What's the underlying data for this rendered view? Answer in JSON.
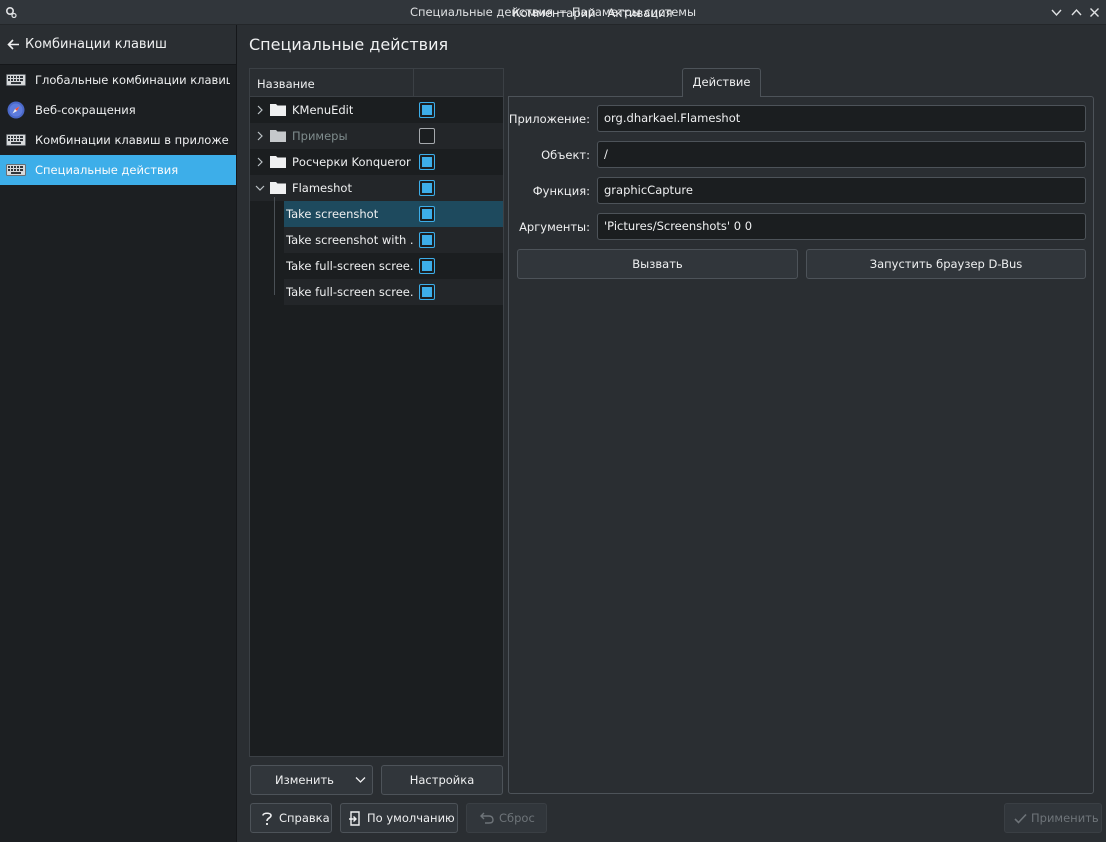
{
  "window": {
    "title": "Специальные действия — Параметры системы",
    "icons": [
      "settings-icon",
      "chevron-down-icon",
      "chevron-up-icon",
      "close-icon"
    ]
  },
  "sidebar": {
    "back_label": "Комбинации клавиш",
    "items": [
      {
        "label": "Глобальные комбинации клавиш",
        "icon": "keyboard-icon"
      },
      {
        "label": "Веб-сокращения",
        "icon": "compass-icon"
      },
      {
        "label": "Комбинации клавиш в приложе...",
        "icon": "keyboard-icon"
      },
      {
        "label": "Специальные действия",
        "icon": "keyboard-icon"
      }
    ]
  },
  "page": {
    "title": "Специальные действия"
  },
  "tree": {
    "header": "Название",
    "rows": [
      {
        "name": "KMenuEdit",
        "enabled": true
      },
      {
        "name": "Примеры",
        "enabled": false
      },
      {
        "name": "Росчерки Konqueror",
        "enabled": true
      },
      {
        "name": "Flameshot",
        "enabled": true
      },
      {
        "name": "Take screenshot",
        "enabled": true
      },
      {
        "name": "Take screenshot with ...",
        "enabled": true
      },
      {
        "name": "Take full-screen scree...",
        "enabled": true
      },
      {
        "name": "Take full-screen scree...",
        "enabled": true
      }
    ],
    "edit_button": "Изменить",
    "settings_button": "Настройка"
  },
  "tabs": [
    "Комментарий",
    "Активация",
    "Действие"
  ],
  "action": {
    "app_label": "Приложение:",
    "app_value": "org.dharkael.Flameshot",
    "object_label": "Объект:",
    "object_value": "/",
    "function_label": "Функция:",
    "function_value": "graphicCapture",
    "args_label": "Аргументы:",
    "args_value": "'Pictures/Screenshots' 0 0",
    "call_button": "Вызвать",
    "dbus_button": "Запустить браузер D-Bus"
  },
  "footer": {
    "help": "Справка",
    "defaults": "По умолчанию",
    "reset": "Сброс",
    "apply": "Применить"
  },
  "colors": {
    "accent": "#3daee9",
    "background": "#2a2e32",
    "sidebar": "#1c1f22",
    "selection": "#1e4a5e"
  }
}
